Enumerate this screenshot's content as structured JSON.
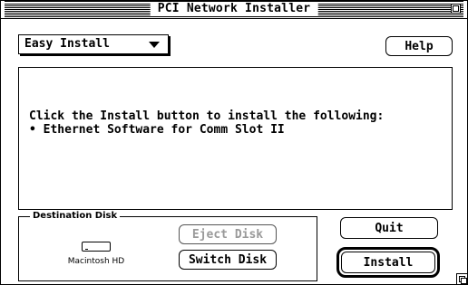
{
  "window": {
    "title": "PCI Network Installer"
  },
  "install_mode": {
    "selected": "Easy Install"
  },
  "buttons": {
    "help": "Help",
    "eject_disk": "Eject Disk",
    "switch_disk": "Switch Disk",
    "quit": "Quit",
    "install": "Install"
  },
  "message": {
    "line1": "Click the Install button to install the following:",
    "line2": "• Ethernet Software for Comm Slot II"
  },
  "destination": {
    "group_label": "Destination Disk",
    "disk_name": "Macintosh HD"
  },
  "icons": {
    "zoom": "zoom-box-icon",
    "disk": "hard-disk-icon",
    "dropdown": "triangle-down-icon",
    "resize": "grow-box-icon"
  }
}
